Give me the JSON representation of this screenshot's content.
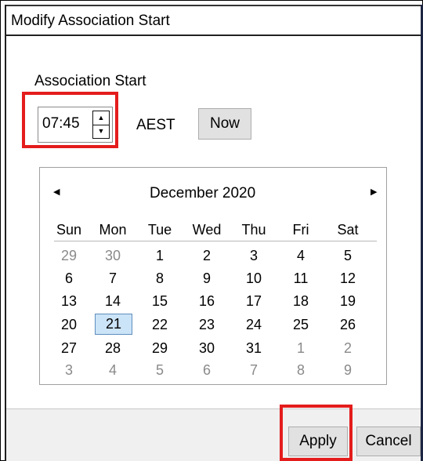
{
  "dialog": {
    "title": "Modify Association Start",
    "section_label": "Association Start",
    "time_value": "07:45",
    "timezone": "AEST",
    "now_label": "Now",
    "apply_label": "Apply",
    "cancel_label": "Cancel"
  },
  "calendar": {
    "month_label": "December 2020",
    "weekdays": [
      "Sun",
      "Mon",
      "Tue",
      "Wed",
      "Thu",
      "Fri",
      "Sat"
    ],
    "selected_day": "21",
    "weeks": [
      [
        {
          "d": "29",
          "o": true
        },
        {
          "d": "30",
          "o": true
        },
        {
          "d": "1"
        },
        {
          "d": "2"
        },
        {
          "d": "3"
        },
        {
          "d": "4"
        },
        {
          "d": "5"
        }
      ],
      [
        {
          "d": "6"
        },
        {
          "d": "7"
        },
        {
          "d": "8"
        },
        {
          "d": "9"
        },
        {
          "d": "10"
        },
        {
          "d": "11"
        },
        {
          "d": "12"
        }
      ],
      [
        {
          "d": "13"
        },
        {
          "d": "14"
        },
        {
          "d": "15"
        },
        {
          "d": "16"
        },
        {
          "d": "17"
        },
        {
          "d": "18"
        },
        {
          "d": "19"
        }
      ],
      [
        {
          "d": "20"
        },
        {
          "d": "21",
          "s": true
        },
        {
          "d": "22"
        },
        {
          "d": "23"
        },
        {
          "d": "24"
        },
        {
          "d": "25"
        },
        {
          "d": "26"
        }
      ],
      [
        {
          "d": "27"
        },
        {
          "d": "28"
        },
        {
          "d": "29"
        },
        {
          "d": "30"
        },
        {
          "d": "31"
        },
        {
          "d": "1",
          "o": true
        },
        {
          "d": "2",
          "o": true
        }
      ],
      [
        {
          "d": "3",
          "o": true
        },
        {
          "d": "4",
          "o": true
        },
        {
          "d": "5",
          "o": true
        },
        {
          "d": "6",
          "o": true
        },
        {
          "d": "7",
          "o": true
        },
        {
          "d": "8",
          "o": true
        },
        {
          "d": "9",
          "o": true
        }
      ]
    ]
  },
  "colors": {
    "highlight": "#e41c1c",
    "selected_day_bg": "#cce4f7",
    "other_month_text": "#8a8a8a"
  },
  "icons": {
    "prev": "triangle-left-icon",
    "next": "triangle-right-icon",
    "spin_up": "triangle-up-icon",
    "spin_down": "triangle-down-icon"
  }
}
